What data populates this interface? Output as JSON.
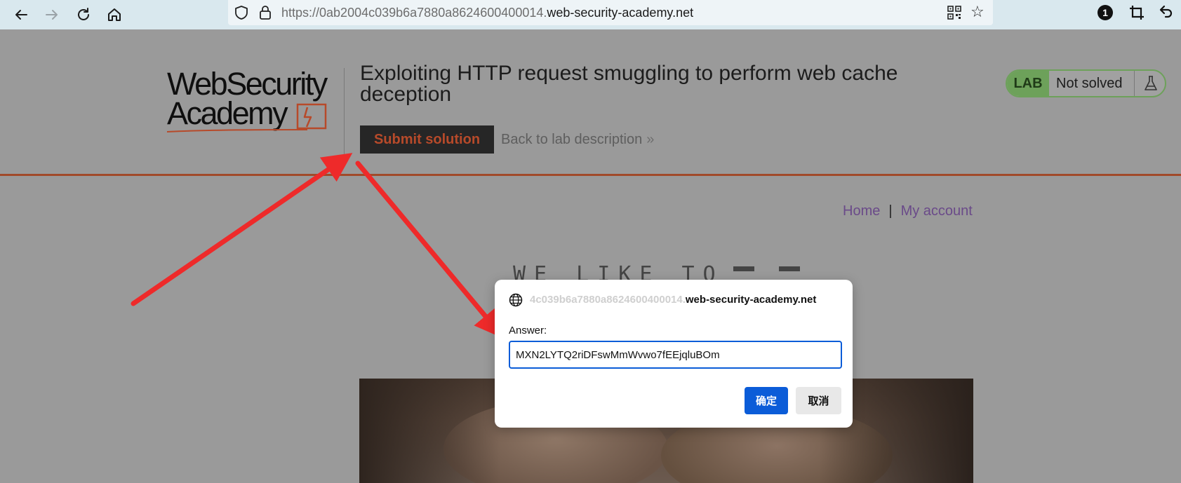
{
  "browser": {
    "url_prefix": "https://0ab2004c039b6a7880a8624600400014.",
    "url_host": "web-security-academy.net",
    "extension_badge_count": "1",
    "icons": {
      "back": "arrow-left-icon",
      "forward": "arrow-right-icon",
      "reload": "reload-icon",
      "home": "home-icon",
      "shield": "shield-icon",
      "lock": "lock-icon",
      "qr": "qr-code-icon",
      "bookmark": "star-icon",
      "crop": "crop-icon",
      "undo": "undo-icon"
    }
  },
  "header": {
    "logo_line1": "WebSecurity",
    "logo_line2": "Academy",
    "lab_title": "Exploiting HTTP request smuggling to perform web cache deception",
    "submit_label": "Submit solution",
    "back_label": "Back to lab description",
    "lab_badge": "LAB",
    "lab_status": "Not solved"
  },
  "nav": {
    "home": "Home",
    "separator": "|",
    "account": "My account"
  },
  "banner": {
    "text": "WE LIKE TO"
  },
  "dialog": {
    "origin_faded": "4c039b6a7880a8624600400014.",
    "origin_host": "web-security-academy.net",
    "answer_label": "Answer:",
    "answer_value": "MXN2LYTQ2riDFswMmWvwo7fEEjqluBOm",
    "ok_label": "确定",
    "cancel_label": "取消"
  },
  "colors": {
    "accent_orange": "#b74a2a",
    "arrow_red": "#ee2a2a",
    "lab_green": "#6da15a",
    "link_purple": "#6a4a89",
    "dialog_blue": "#0b5cd8"
  }
}
